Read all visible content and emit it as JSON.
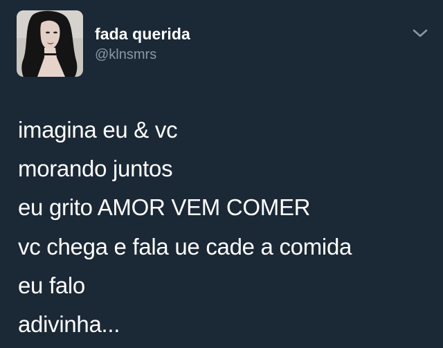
{
  "tweet": {
    "author": {
      "display_name": "fada querida",
      "handle": "@klnsmrs",
      "avatar_icon": "profile-photo-avatar"
    },
    "menu_icon": "chevron-down-icon",
    "lines": [
      "imagina eu & vc",
      "morando juntos",
      "eu grito AMOR VEM COMER",
      "vc chega e fala ue cade a comida",
      "eu falo",
      "adivinha..."
    ]
  },
  "colors": {
    "background": "#1b2836",
    "text": "#ffffff",
    "secondary_text": "#8899a6"
  }
}
